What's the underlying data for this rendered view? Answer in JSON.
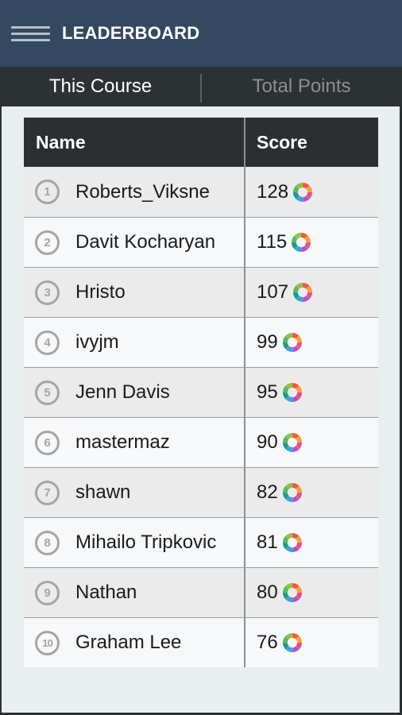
{
  "appbar": {
    "title": "LEADERBOARD",
    "menu_icon": "hamburger-menu-icon"
  },
  "tabs": [
    {
      "label": "This Course",
      "active": true
    },
    {
      "label": "Total Points",
      "active": false
    }
  ],
  "table": {
    "headers": {
      "name": "Name",
      "score": "Score"
    },
    "score_icon": "sololearn-logo-icon",
    "rows": [
      {
        "rank": "1",
        "name": "Roberts_Viksne",
        "score": "128"
      },
      {
        "rank": "2",
        "name": "Davit Kocharyan",
        "score": "115"
      },
      {
        "rank": "3",
        "name": "Hristo",
        "score": "107"
      },
      {
        "rank": "4",
        "name": "ivyjm",
        "score": "99"
      },
      {
        "rank": "5",
        "name": "Jenn Davis",
        "score": "95"
      },
      {
        "rank": "6",
        "name": "mastermaz",
        "score": "90"
      },
      {
        "rank": "7",
        "name": "shawn",
        "score": "82"
      },
      {
        "rank": "8",
        "name": "Mihailo Tripkovic",
        "score": "81"
      },
      {
        "rank": "9",
        "name": "Nathan",
        "score": "80"
      },
      {
        "rank": "10",
        "name": "Graham Lee",
        "score": "76"
      }
    ]
  },
  "colors": {
    "appbar_bg": "#34495f",
    "tabs_bg": "#2c3133",
    "content_bg": "#e9eeee",
    "table_header_bg": "#2b2f31",
    "rank_circle": "#a5a5a5"
  }
}
